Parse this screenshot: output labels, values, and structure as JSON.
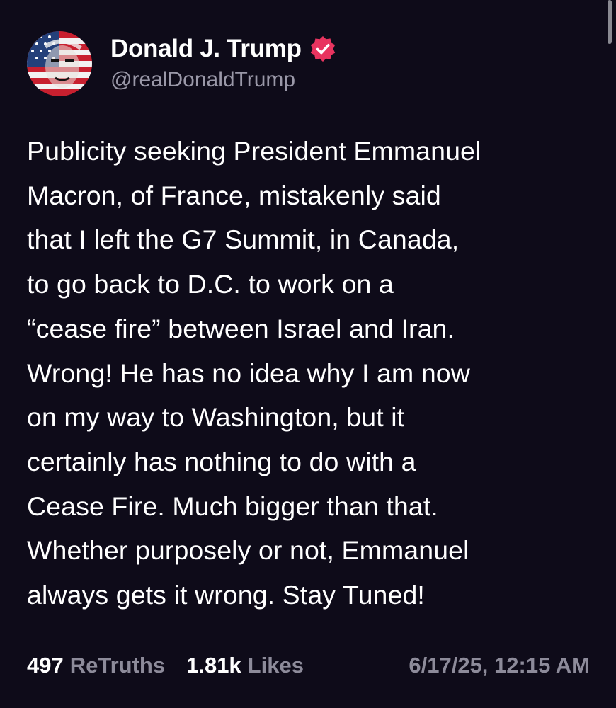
{
  "post": {
    "author": {
      "display_name": "Donald J. Trump",
      "handle": "@realDonaldTrump",
      "verified_badge_icon": "verified-badge-icon",
      "avatar_icon": "avatar-flag-portrait"
    },
    "text_lines": [
      "Publicity seeking President Emmanuel",
      "Macron, of France, mistakenly said",
      "that I left the G7 Summit, in Canada,",
      "to go back to D.C. to work on a",
      "“cease fire” between Israel and Iran.",
      "Wrong! He has no idea why I am now",
      "on my way to Washington, but it",
      "certainly has nothing to do with a",
      "Cease Fire. Much bigger than that.",
      "Whether purposely or not, Emmanuel",
      "always gets it wrong. Stay Tuned!"
    ],
    "stats": {
      "retruths_count": "497",
      "retruths_label": "ReTruths",
      "likes_count": "1.81k",
      "likes_label": "Likes"
    },
    "timestamp": "6/17/25, 12:15 AM"
  },
  "colors": {
    "background": "#0e0b19",
    "text_primary": "#ffffff",
    "text_secondary": "#8d8b9a",
    "verified_badge": "#e8345f"
  }
}
